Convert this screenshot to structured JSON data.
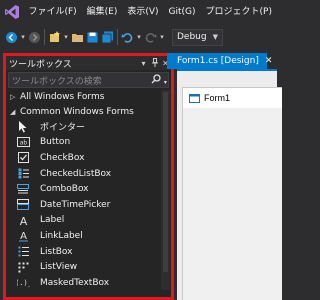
{
  "menubar": {
    "items": [
      "ファイル(F)",
      "編集(E)",
      "表示(V)",
      "Git(G)",
      "プロジェクト(P)"
    ]
  },
  "toolbar": {
    "config": "Debug"
  },
  "toolbox": {
    "title": "ツールボックス",
    "search_placeholder": "ツールボックスの検索",
    "group_all": "All Windows Forms",
    "group_common": "Common Windows Forms",
    "items": [
      {
        "label": "ポインター",
        "icon": "pointer-icon"
      },
      {
        "label": "Button",
        "icon": "button-icon"
      },
      {
        "label": "CheckBox",
        "icon": "checkbox-icon"
      },
      {
        "label": "CheckedListBox",
        "icon": "checkedlistbox-icon"
      },
      {
        "label": "ComboBox",
        "icon": "combobox-icon"
      },
      {
        "label": "DateTimePicker",
        "icon": "datetimepicker-icon"
      },
      {
        "label": "Label",
        "icon": "label-icon"
      },
      {
        "label": "LinkLabel",
        "icon": "linklabel-icon"
      },
      {
        "label": "ListBox",
        "icon": "listbox-icon"
      },
      {
        "label": "ListView",
        "icon": "listview-icon"
      },
      {
        "label": "MaskedTextBox",
        "icon": "maskedtextbox-icon"
      }
    ]
  },
  "document": {
    "tab_label": "Form1.cs [Design]",
    "form_title": "Form1"
  },
  "colors": {
    "accent": "#007acc",
    "highlight_border": "#e0181f",
    "panel_bg": "#252526"
  }
}
